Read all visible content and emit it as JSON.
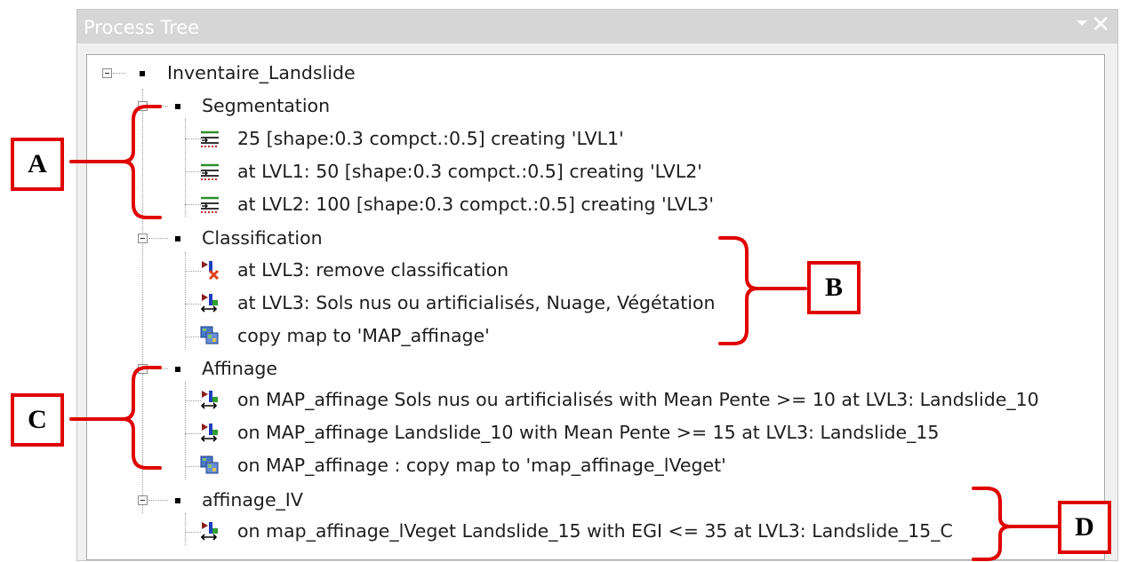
{
  "panel": {
    "title": "Process Tree",
    "menu_icon": "chevron-down-icon",
    "close_icon": "close-icon",
    "close_glyph": "✕"
  },
  "tree": {
    "root": "Inventaire_Landslide",
    "groups": [
      {
        "label": "Segmentation",
        "items": [
          {
            "icon": "segmentation-icon",
            "text": "25 [shape:0.3 compct.:0.5] creating 'LVL1'"
          },
          {
            "icon": "segmentation-icon",
            "text": "at  LVL1: 50 [shape:0.3 compct.:0.5] creating 'LVL2'"
          },
          {
            "icon": "segmentation-icon",
            "text": "at  LVL2: 100 [shape:0.3 compct.:0.5] creating 'LVL3'"
          }
        ]
      },
      {
        "label": "Classification",
        "items": [
          {
            "icon": "remove-classification-icon",
            "text": "at  LVL3: remove classification"
          },
          {
            "icon": "assign-class-icon",
            "text": "at  LVL3: Sols nus ou artificialisés, Nuage, Végétation"
          },
          {
            "icon": "copy-map-icon",
            "text": "copy map to 'MAP_affinage'"
          }
        ]
      },
      {
        "label": "Affinage",
        "items": [
          {
            "icon": "assign-class-icon",
            "text": "on MAP_affinage Sols nus ou artificialisés with Mean Pente >= 10  at  LVL3: Landslide_10"
          },
          {
            "icon": "assign-class-icon",
            "text": "on MAP_affinage Landslide_10 with Mean Pente >= 15  at  LVL3: Landslide_15"
          },
          {
            "icon": "copy-map-icon",
            "text": "on MAP_affinage : copy map to 'map_affinage_lVeget'"
          }
        ]
      },
      {
        "label": "affinage_IV",
        "items": [
          {
            "icon": "assign-class-icon",
            "text": "on map_affinage_lVeget Landslide_15 with EGI <= 35  at  LVL3: Landslide_15_C"
          }
        ]
      }
    ]
  },
  "annotations": {
    "labels": [
      "A",
      "B",
      "C",
      "D"
    ],
    "color": "#e00000"
  }
}
